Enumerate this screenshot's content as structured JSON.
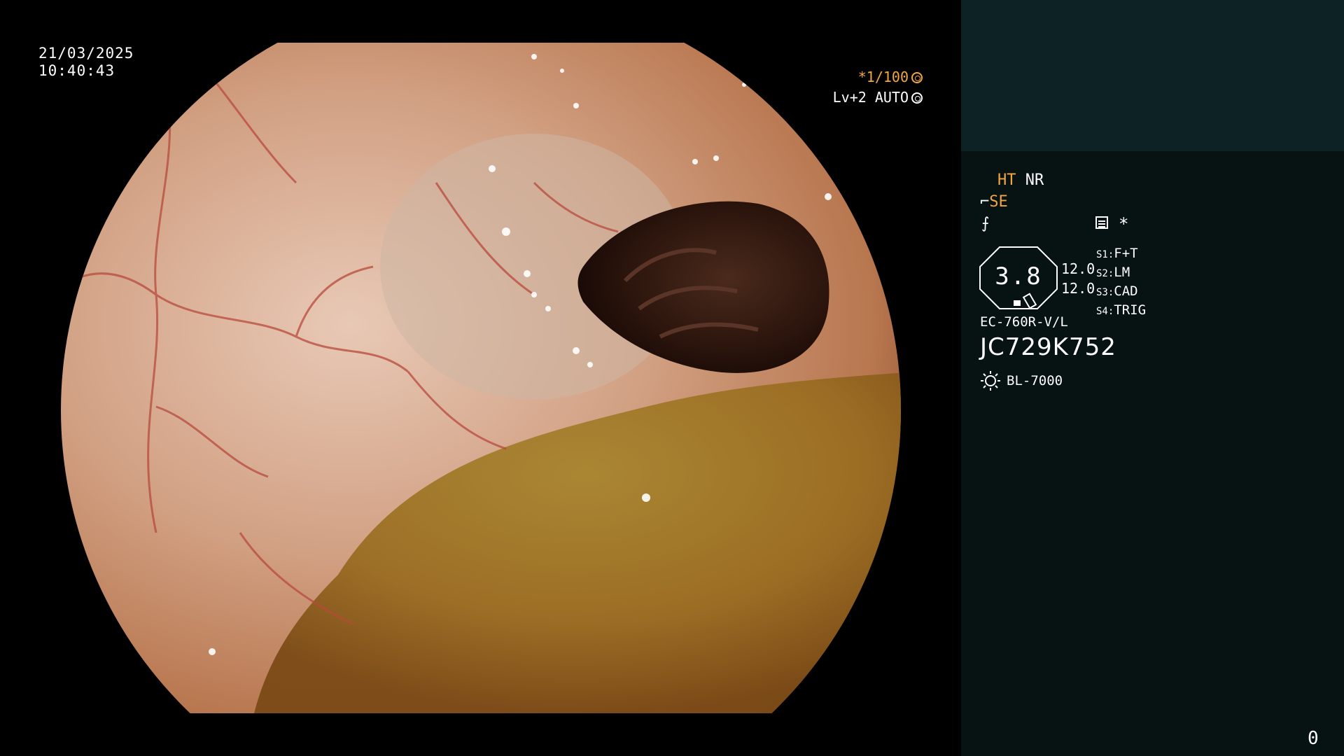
{
  "overlay": {
    "date": "21/03/2025",
    "time": "10:40:43",
    "shutter": "*1/100",
    "level": "Lv+2 AUTO"
  },
  "panel": {
    "ht": "HT",
    "nr": "NR",
    "se": "SE",
    "fx": "⨍",
    "asterisk": "*",
    "value_main": "3.8",
    "value_1": "12.0",
    "value_2": "12.0",
    "slots": [
      {
        "key": "S1:",
        "value": "F+T"
      },
      {
        "key": "S2:",
        "value": "LM"
      },
      {
        "key": "S3:",
        "value": "CAD"
      },
      {
        "key": "S4:",
        "value": "TRIG"
      }
    ],
    "scope_model": "EC-760R-V/L",
    "serial": "JC729K752",
    "light_source": "BL-7000",
    "corner_value": "0"
  },
  "colors": {
    "panel_bg": "#071212",
    "panel_top_bg": "#0c2224",
    "accent_orange": "#f4a640"
  },
  "icons": [
    "aperture-icon",
    "scope-icon",
    "menu-icon",
    "sun-icon",
    "octagon-gauge-icon"
  ]
}
